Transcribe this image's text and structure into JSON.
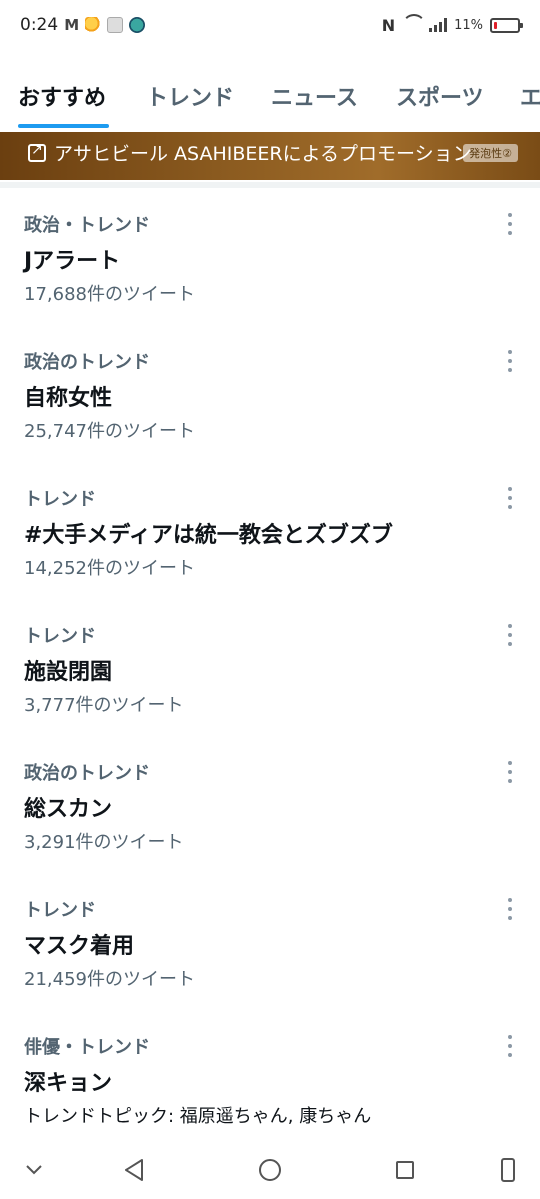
{
  "status_bar": {
    "time": "0:24",
    "mail_icon": "M",
    "battery_percent": "11%",
    "battery_level": 0.11,
    "nfc_label": "N"
  },
  "tabs": [
    {
      "label": "おすすめ",
      "active": true
    },
    {
      "label": "トレンド",
      "active": false
    },
    {
      "label": "ニュース",
      "active": false
    },
    {
      "label": "スポーツ",
      "active": false
    },
    {
      "label": "エ",
      "active": false
    }
  ],
  "promo": {
    "text": "アサヒビール ASAHIBEERによるプロモーション",
    "badge": "発泡性②"
  },
  "trends": [
    {
      "context": "政治・トレンド",
      "title": "Jアラート",
      "count": "17,688件のツイート"
    },
    {
      "context": "政治のトレンド",
      "title": "自称女性",
      "count": "25,747件のツイート"
    },
    {
      "context": "トレンド",
      "title": "#大手メディアは統一教会とズブズブ",
      "count": "14,252件のツイート"
    },
    {
      "context": "トレンド",
      "title": "施設閉園",
      "count": "3,777件のツイート"
    },
    {
      "context": "政治のトレンド",
      "title": "総スカン",
      "count": "3,291件のツイート"
    },
    {
      "context": "トレンド",
      "title": "マスク着用",
      "count": "21,459件のツイート"
    },
    {
      "context": "俳優・トレンド",
      "title": "深キョン",
      "count": "トレンドトピック: 福原遥ちゃん, 康ちゃん"
    }
  ],
  "colors": {
    "accent": "#1d9bf0",
    "secondary_text": "#536471",
    "primary_text": "#0f1419"
  },
  "navbar": {
    "icons": [
      "chevron-down-icon",
      "back-icon",
      "home-icon",
      "recents-icon",
      "phone-icon"
    ]
  }
}
